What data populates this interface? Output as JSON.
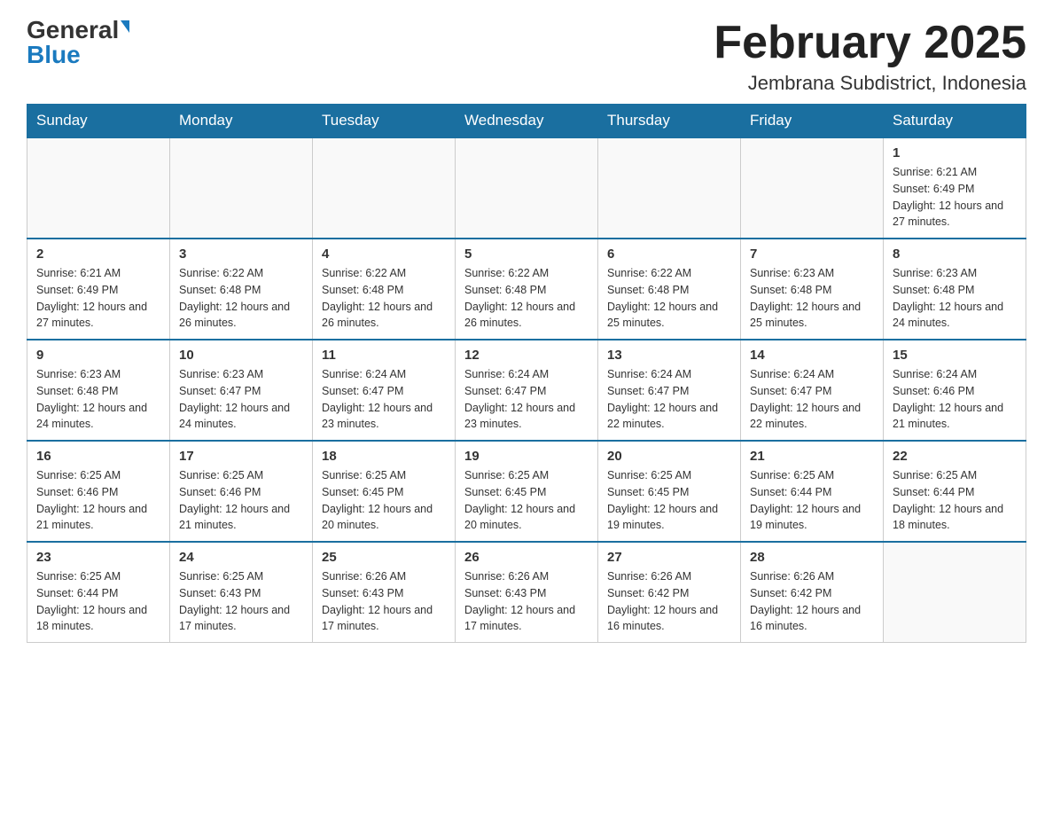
{
  "logo": {
    "general": "General",
    "blue": "Blue"
  },
  "title": "February 2025",
  "subtitle": "Jembrana Subdistrict, Indonesia",
  "weekdays": [
    "Sunday",
    "Monday",
    "Tuesday",
    "Wednesday",
    "Thursday",
    "Friday",
    "Saturday"
  ],
  "weeks": [
    [
      {
        "day": "",
        "info": ""
      },
      {
        "day": "",
        "info": ""
      },
      {
        "day": "",
        "info": ""
      },
      {
        "day": "",
        "info": ""
      },
      {
        "day": "",
        "info": ""
      },
      {
        "day": "",
        "info": ""
      },
      {
        "day": "1",
        "info": "Sunrise: 6:21 AM\nSunset: 6:49 PM\nDaylight: 12 hours and 27 minutes."
      }
    ],
    [
      {
        "day": "2",
        "info": "Sunrise: 6:21 AM\nSunset: 6:49 PM\nDaylight: 12 hours and 27 minutes."
      },
      {
        "day": "3",
        "info": "Sunrise: 6:22 AM\nSunset: 6:48 PM\nDaylight: 12 hours and 26 minutes."
      },
      {
        "day": "4",
        "info": "Sunrise: 6:22 AM\nSunset: 6:48 PM\nDaylight: 12 hours and 26 minutes."
      },
      {
        "day": "5",
        "info": "Sunrise: 6:22 AM\nSunset: 6:48 PM\nDaylight: 12 hours and 26 minutes."
      },
      {
        "day": "6",
        "info": "Sunrise: 6:22 AM\nSunset: 6:48 PM\nDaylight: 12 hours and 25 minutes."
      },
      {
        "day": "7",
        "info": "Sunrise: 6:23 AM\nSunset: 6:48 PM\nDaylight: 12 hours and 25 minutes."
      },
      {
        "day": "8",
        "info": "Sunrise: 6:23 AM\nSunset: 6:48 PM\nDaylight: 12 hours and 24 minutes."
      }
    ],
    [
      {
        "day": "9",
        "info": "Sunrise: 6:23 AM\nSunset: 6:48 PM\nDaylight: 12 hours and 24 minutes."
      },
      {
        "day": "10",
        "info": "Sunrise: 6:23 AM\nSunset: 6:47 PM\nDaylight: 12 hours and 24 minutes."
      },
      {
        "day": "11",
        "info": "Sunrise: 6:24 AM\nSunset: 6:47 PM\nDaylight: 12 hours and 23 minutes."
      },
      {
        "day": "12",
        "info": "Sunrise: 6:24 AM\nSunset: 6:47 PM\nDaylight: 12 hours and 23 minutes."
      },
      {
        "day": "13",
        "info": "Sunrise: 6:24 AM\nSunset: 6:47 PM\nDaylight: 12 hours and 22 minutes."
      },
      {
        "day": "14",
        "info": "Sunrise: 6:24 AM\nSunset: 6:47 PM\nDaylight: 12 hours and 22 minutes."
      },
      {
        "day": "15",
        "info": "Sunrise: 6:24 AM\nSunset: 6:46 PM\nDaylight: 12 hours and 21 minutes."
      }
    ],
    [
      {
        "day": "16",
        "info": "Sunrise: 6:25 AM\nSunset: 6:46 PM\nDaylight: 12 hours and 21 minutes."
      },
      {
        "day": "17",
        "info": "Sunrise: 6:25 AM\nSunset: 6:46 PM\nDaylight: 12 hours and 21 minutes."
      },
      {
        "day": "18",
        "info": "Sunrise: 6:25 AM\nSunset: 6:45 PM\nDaylight: 12 hours and 20 minutes."
      },
      {
        "day": "19",
        "info": "Sunrise: 6:25 AM\nSunset: 6:45 PM\nDaylight: 12 hours and 20 minutes."
      },
      {
        "day": "20",
        "info": "Sunrise: 6:25 AM\nSunset: 6:45 PM\nDaylight: 12 hours and 19 minutes."
      },
      {
        "day": "21",
        "info": "Sunrise: 6:25 AM\nSunset: 6:44 PM\nDaylight: 12 hours and 19 minutes."
      },
      {
        "day": "22",
        "info": "Sunrise: 6:25 AM\nSunset: 6:44 PM\nDaylight: 12 hours and 18 minutes."
      }
    ],
    [
      {
        "day": "23",
        "info": "Sunrise: 6:25 AM\nSunset: 6:44 PM\nDaylight: 12 hours and 18 minutes."
      },
      {
        "day": "24",
        "info": "Sunrise: 6:25 AM\nSunset: 6:43 PM\nDaylight: 12 hours and 17 minutes."
      },
      {
        "day": "25",
        "info": "Sunrise: 6:26 AM\nSunset: 6:43 PM\nDaylight: 12 hours and 17 minutes."
      },
      {
        "day": "26",
        "info": "Sunrise: 6:26 AM\nSunset: 6:43 PM\nDaylight: 12 hours and 17 minutes."
      },
      {
        "day": "27",
        "info": "Sunrise: 6:26 AM\nSunset: 6:42 PM\nDaylight: 12 hours and 16 minutes."
      },
      {
        "day": "28",
        "info": "Sunrise: 6:26 AM\nSunset: 6:42 PM\nDaylight: 12 hours and 16 minutes."
      },
      {
        "day": "",
        "info": ""
      }
    ]
  ]
}
